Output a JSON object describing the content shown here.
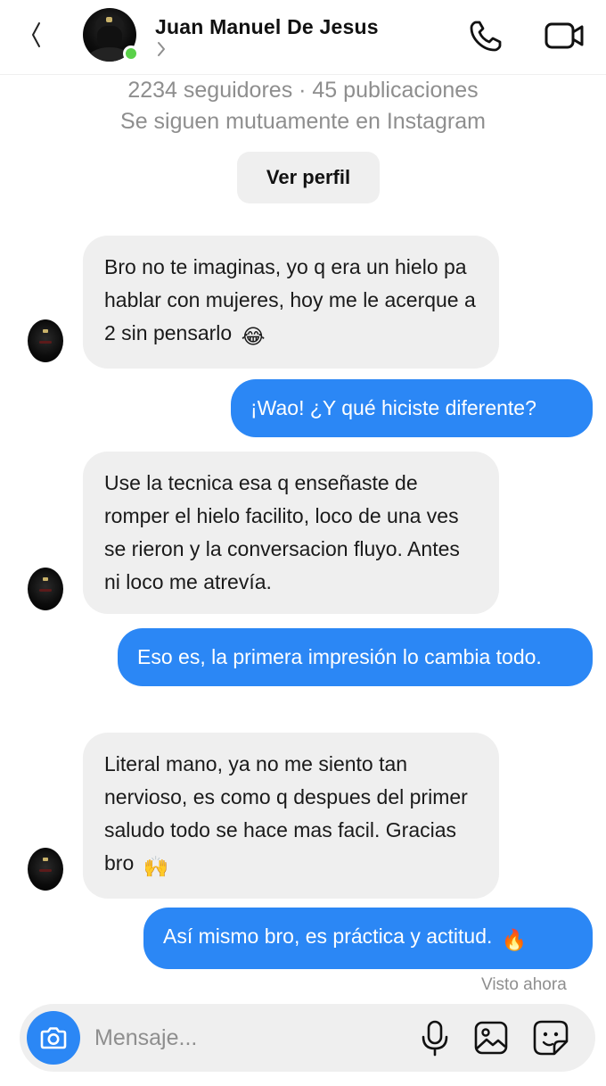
{
  "header": {
    "contact_name": "Juan Manuel De Jesus",
    "icons": {
      "back": "back-icon",
      "chevron": "chevron-right-icon",
      "call": "phone-icon",
      "video": "video-camera-icon"
    }
  },
  "profile": {
    "stats": "2234 seguidores · 45 publicaciones",
    "mutual": "Se siguen mutuamente en Instagram",
    "view_profile_label": "Ver perfil"
  },
  "messages": [
    {
      "direction": "incoming",
      "text": "Bro no te imaginas, yo q era un hielo pa hablar con mujeres, hoy me le acerque a 2 sin pensarlo",
      "emoji": "😂"
    },
    {
      "direction": "outgoing",
      "text": "¡Wao! ¿Y qué hiciste diferente?"
    },
    {
      "direction": "incoming",
      "text": "Use la tecnica esa q enseñaste de romper el hielo facilito, loco de una ves se rieron y la conversacion fluyo. Antes ni loco me atrevía."
    },
    {
      "direction": "outgoing",
      "text": "Eso es, la primera impresión lo cambia todo."
    },
    {
      "direction": "incoming",
      "text": "Literal mano, ya no me siento tan nervioso, es como q despues del primer saludo todo se hace mas facil. Gracias bro",
      "emoji": "🙌"
    },
    {
      "direction": "outgoing",
      "text": "Así mismo bro, es práctica y actitud.",
      "emoji": "🔥"
    }
  ],
  "seen_status": "Visto ahora",
  "composer": {
    "placeholder": "Mensaje...",
    "icons": [
      "camera-icon",
      "microphone-icon",
      "image-icon",
      "sticker-icon"
    ]
  },
  "colors": {
    "accent": "#2b87f5",
    "incoming_bubble": "#efefef",
    "online": "#5ad14a",
    "muted_text": "#8e8e8e"
  }
}
